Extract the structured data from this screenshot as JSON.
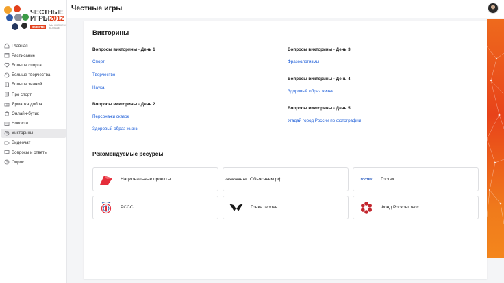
{
  "app": {
    "logo": {
      "line1": "ЧЕСТНЫЕ",
      "line2": "ИГРЫ",
      "year": "2012",
      "badge": "ВМЕСТЕ",
      "badge_note": "МЫ СМОЖЕМ БОЛЬШЕ!"
    }
  },
  "sidebar": {
    "items": [
      {
        "label": "Главная",
        "icon": "home-icon"
      },
      {
        "label": "Расписание",
        "icon": "calendar-icon"
      },
      {
        "label": "Больше спорта",
        "icon": "heart-icon"
      },
      {
        "label": "Больше творчества",
        "icon": "palette-icon"
      },
      {
        "label": "Больше знаний",
        "icon": "book-icon"
      },
      {
        "label": "Про спорт",
        "icon": "document-icon"
      },
      {
        "label": "Ярмарка добра",
        "icon": "gift-icon"
      },
      {
        "label": "Онлайн-бутик",
        "icon": "shop-icon"
      },
      {
        "label": "Новости",
        "icon": "news-icon"
      },
      {
        "label": "Викторины",
        "icon": "question-icon",
        "active": true
      },
      {
        "label": "Видеочат",
        "icon": "video-icon"
      },
      {
        "label": "Вопросы и ответы",
        "icon": "chat-icon"
      },
      {
        "label": "Опрос",
        "icon": "poll-icon"
      }
    ]
  },
  "header": {
    "title": "Честные игры"
  },
  "main": {
    "title": "Викторины",
    "days": [
      {
        "heading": "Вопросы викторины - День 1",
        "links": [
          "Спорт",
          "Творчество",
          "Наука"
        ]
      },
      {
        "heading": "Вопросы викторины - День 2",
        "links": [
          "Персонажи сказок",
          "Здоровый образ жизни"
        ]
      },
      {
        "heading": "Вопросы викторины - День 3",
        "links": [
          "Фразеологизмы"
        ]
      },
      {
        "heading": "Вопросы викторины - День 4",
        "links": [
          "Здоровый образ жизни"
        ]
      },
      {
        "heading": "Вопросы викторины - День 5",
        "links": [
          "Угадай город России по фотографии"
        ]
      }
    ],
    "resources_title": "Рекомендуемые ресурсы",
    "resources": [
      {
        "label": "Национальные проекты",
        "logo_icon": "national-projects-logo-icon"
      },
      {
        "label": "Объясняем.рф",
        "logo_icon": "obyasnyaem-logo-icon",
        "logo_text": "ОБЪЯСНЯЕМ.РФ"
      },
      {
        "label": "Гостех",
        "logo_icon": "gostech-logo-icon",
        "logo_text": "ГОСТЕХ"
      },
      {
        "label": "РССС",
        "logo_icon": "rsss-logo-icon"
      },
      {
        "label": "Гонка героев",
        "logo_icon": "gonka-geroev-logo-icon"
      },
      {
        "label": "Фонд Росконгресс",
        "logo_icon": "roscongress-logo-icon"
      }
    ]
  },
  "colors": {
    "accent": "#e2401c",
    "link": "#1f5fd8",
    "active_bg": "#e9e9eb"
  }
}
